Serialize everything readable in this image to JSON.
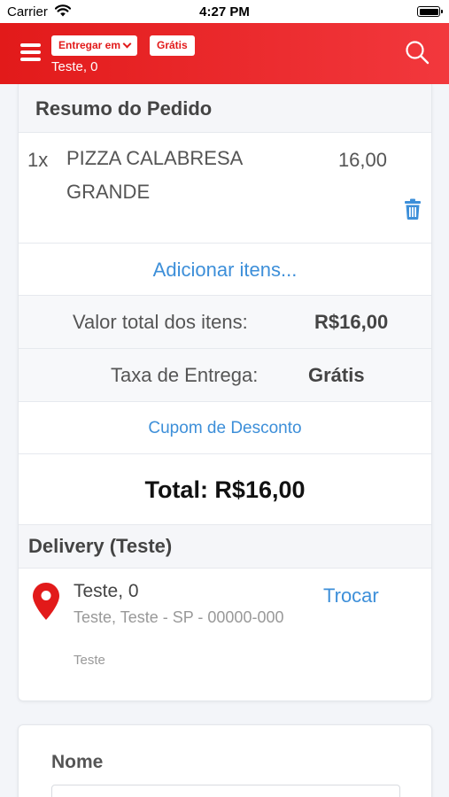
{
  "status_bar": {
    "carrier": "Carrier",
    "time": "4:27 PM"
  },
  "header": {
    "deliver_label": "Entregar em",
    "free_label": "Grátis",
    "address": "Teste, 0"
  },
  "summary": {
    "title": "Resumo do Pedido",
    "items": [
      {
        "qty": "1x",
        "name": "PIZZA CALABRESA GRANDE",
        "price": "16,00"
      }
    ],
    "add_items": "Adicionar itens...",
    "subtotal_label": "Valor total dos itens:",
    "subtotal_value": "R$16,00",
    "fee_label": "Taxa de Entrega:",
    "fee_value": "Grátis",
    "coupon": "Cupom de Desconto",
    "total": "Total: R$16,00"
  },
  "delivery": {
    "title": "Delivery (Teste)",
    "line1": "Teste, 0",
    "line2": "Teste, Teste - SP - 00000-000",
    "line3": "Teste",
    "change": "Trocar"
  },
  "form": {
    "name_label": "Nome",
    "name_value": ""
  },
  "colors": {
    "brand_red": "#e21a1a",
    "link_blue": "#3d8fd9"
  }
}
